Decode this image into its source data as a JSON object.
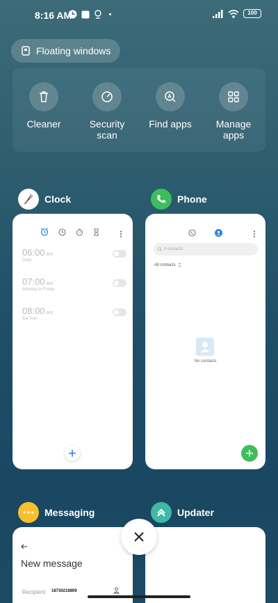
{
  "status_bar": {
    "time": "8:16 AM",
    "battery": "100"
  },
  "floating_windows": {
    "label": "Floating windows"
  },
  "quick_tools": [
    {
      "label": "Cleaner",
      "icon": "trash-icon"
    },
    {
      "label": "Security\nscan",
      "icon": "security-scan-icon"
    },
    {
      "label": "Find apps",
      "icon": "find-apps-icon"
    },
    {
      "label": "Manage\napps",
      "icon": "grid-icon"
    }
  ],
  "recent_apps": {
    "clock": {
      "name": "Clock",
      "alarms": [
        {
          "time": "06:00",
          "ampm": "am",
          "repeat": "Daily"
        },
        {
          "time": "07:00",
          "ampm": "am",
          "repeat": "Monday to Friday"
        },
        {
          "time": "08:00",
          "ampm": "am",
          "repeat": "Sat Sun"
        }
      ]
    },
    "phone": {
      "name": "Phone",
      "search_placeholder": "0 contacts",
      "filter": "All contacts",
      "empty_text": "No contacts"
    },
    "messaging": {
      "name": "Messaging",
      "title": "New message",
      "recipient_label": "Recipient",
      "recipient_value": "18730218809"
    },
    "updater": {
      "name": "Updater"
    }
  },
  "colors": {
    "accent_blue": "#2a82e4",
    "phone_green": "#3dbd5c",
    "messaging_yellow": "#f6c02e",
    "updater_teal": "#3fb8a4"
  }
}
